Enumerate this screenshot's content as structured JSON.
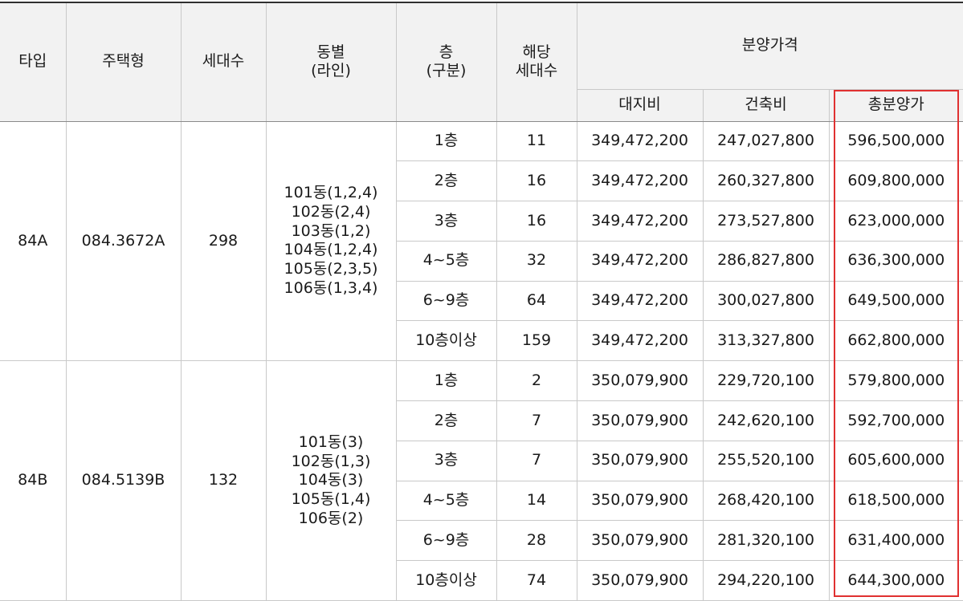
{
  "header": {
    "type": "타입",
    "model": "주택형",
    "units": "세대수",
    "building_line": [
      "동별",
      "(라인)"
    ],
    "floor": [
      "층",
      "(구분)"
    ],
    "floor_units": [
      "해당",
      "세대수"
    ],
    "price": "분양가격",
    "land": "대지비",
    "construction": "건축비",
    "total": "총분양가"
  },
  "groups": [
    {
      "type": "84A",
      "model": "084.3672A",
      "units": "298",
      "buildings": [
        "101동(1,2,4)",
        "102동(2,4)",
        "103동(1,2)",
        "104동(1,2,4)",
        "105동(2,3,5)",
        "106동(1,3,4)"
      ],
      "rows": [
        {
          "floor": "1층",
          "count": "11",
          "land": "349,472,200",
          "construction": "247,027,800",
          "total": "596,500,000"
        },
        {
          "floor": "2층",
          "count": "16",
          "land": "349,472,200",
          "construction": "260,327,800",
          "total": "609,800,000"
        },
        {
          "floor": "3층",
          "count": "16",
          "land": "349,472,200",
          "construction": "273,527,800",
          "total": "623,000,000"
        },
        {
          "floor": "4~5층",
          "count": "32",
          "land": "349,472,200",
          "construction": "286,827,800",
          "total": "636,300,000"
        },
        {
          "floor": "6~9층",
          "count": "64",
          "land": "349,472,200",
          "construction": "300,027,800",
          "total": "649,500,000"
        },
        {
          "floor": "10층이상",
          "count": "159",
          "land": "349,472,200",
          "construction": "313,327,800",
          "total": "662,800,000"
        }
      ]
    },
    {
      "type": "84B",
      "model": "084.5139B",
      "units": "132",
      "buildings": [
        "101동(3)",
        "102동(1,3)",
        "104동(3)",
        "105동(1,4)",
        "106동(2)"
      ],
      "rows": [
        {
          "floor": "1층",
          "count": "2",
          "land": "350,079,900",
          "construction": "229,720,100",
          "total": "579,800,000"
        },
        {
          "floor": "2층",
          "count": "7",
          "land": "350,079,900",
          "construction": "242,620,100",
          "total": "592,700,000"
        },
        {
          "floor": "3층",
          "count": "7",
          "land": "350,079,900",
          "construction": "255,520,100",
          "total": "605,600,000"
        },
        {
          "floor": "4~5층",
          "count": "14",
          "land": "350,079,900",
          "construction": "268,420,100",
          "total": "618,500,000"
        },
        {
          "floor": "6~9층",
          "count": "28",
          "land": "350,079,900",
          "construction": "281,320,100",
          "total": "631,400,000"
        },
        {
          "floor": "10층이상",
          "count": "74",
          "land": "350,079,900",
          "construction": "294,220,100",
          "total": "644,300,000"
        }
      ]
    }
  ],
  "colors": {
    "highlight": "#e03131",
    "header_bg": "#f2f2f2",
    "grid": "#c9c9c9"
  }
}
